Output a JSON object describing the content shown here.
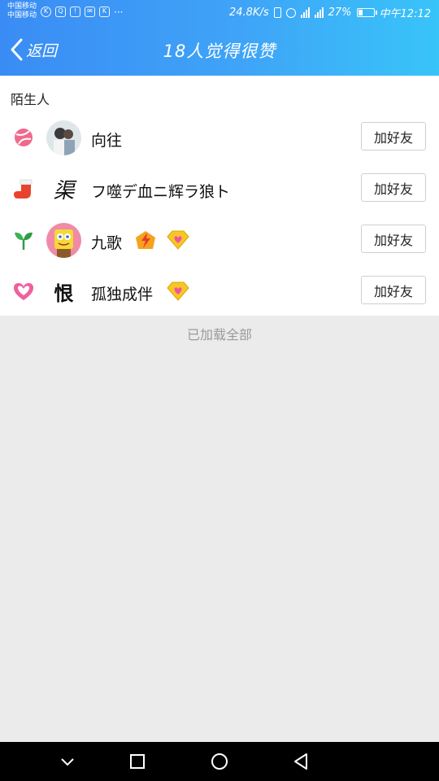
{
  "status_bar": {
    "carrier_1": "中国移动",
    "carrier_2": "中国移动",
    "more": "···",
    "net_speed": "24.8K/s",
    "battery": "27%",
    "time": "中午12:12"
  },
  "header": {
    "back_label": "返回",
    "title": "18人觉得很赞"
  },
  "section_title": "陌生人",
  "users": [
    {
      "name": "向往",
      "badge_icon": "volleyball-icon",
      "avatar_icon": "couple-photo-avatar",
      "extras": [],
      "add_label": "加好友"
    },
    {
      "name": "フ噬デ血ニ辉ラ狼ト",
      "badge_icon": "christmas-stocking-icon",
      "avatar_icon": "calligraphy-avatar",
      "avatar_text": "渠",
      "extras": [],
      "add_label": "加好友"
    },
    {
      "name": "九歌",
      "badge_icon": "sprout-icon",
      "avatar_icon": "spongebob-avatar",
      "extras": [
        "svip-lightning-icon",
        "diamond-heart-icon"
      ],
      "add_label": "加好友"
    },
    {
      "name": "孤独成伴",
      "badge_icon": "pink-heart-icon",
      "avatar_icon": "calligraphy-avatar",
      "avatar_text": "恨",
      "extras": [
        "diamond-heart-icon"
      ],
      "add_label": "加好友"
    }
  ],
  "footer_status": "已加载全部",
  "colors": {
    "header_start": "#3a8cf4",
    "header_end": "#38c4f8",
    "background": "#ebebeb",
    "list_background": "#ffffff"
  }
}
